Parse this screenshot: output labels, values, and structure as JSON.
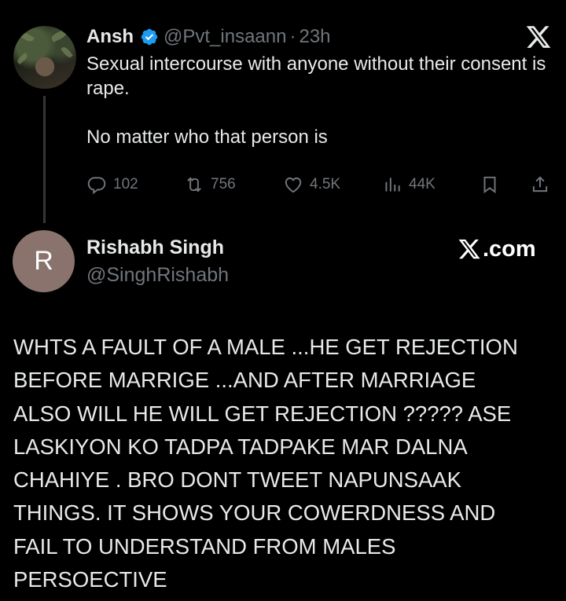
{
  "original_tweet": {
    "author_name": "Ansh",
    "handle": "@Pvt_insaann",
    "separator": "·",
    "time": "23h",
    "text_paragraphs": [
      "Sexual intercourse with anyone without their consent is rape.",
      "No matter who that person is"
    ],
    "stats": {
      "replies": "102",
      "retweets": "756",
      "likes": "4.5K",
      "views": "44K"
    }
  },
  "reply": {
    "avatar_initial": "R",
    "author_name": "Rishabh Singh",
    "handle": "@SinghRishabh",
    "brand": ".com",
    "text": "WHTS A FAULT OF A MALE ...HE GET REJECTION\nBEFORE MARRIGE ...AND AFTER MARRIAGE\nALSO WILL HE WILL GET REJECTION ????? ASE\nLASKIYON KO TADPA TADPAKE MAR DALNA\nCHAHIYE . BRO DONT TWEET NAPUNSAAK\nTHINGS.  IT SHOWS YOUR COWERDNESS AND\nFAIL TO UNDERSTAND FROM MALES\nPERSOECTIVE"
  },
  "icons": [
    "x-logo-icon",
    "verified-badge-icon",
    "reply-icon",
    "retweet-icon",
    "like-icon",
    "views-icon",
    "bookmark-icon",
    "share-icon"
  ],
  "colors": {
    "background": "#000000",
    "text": "#e7e9ea",
    "muted": "#71767b",
    "verified": "#1d9bf0",
    "avatar_r": "#8a736c"
  }
}
